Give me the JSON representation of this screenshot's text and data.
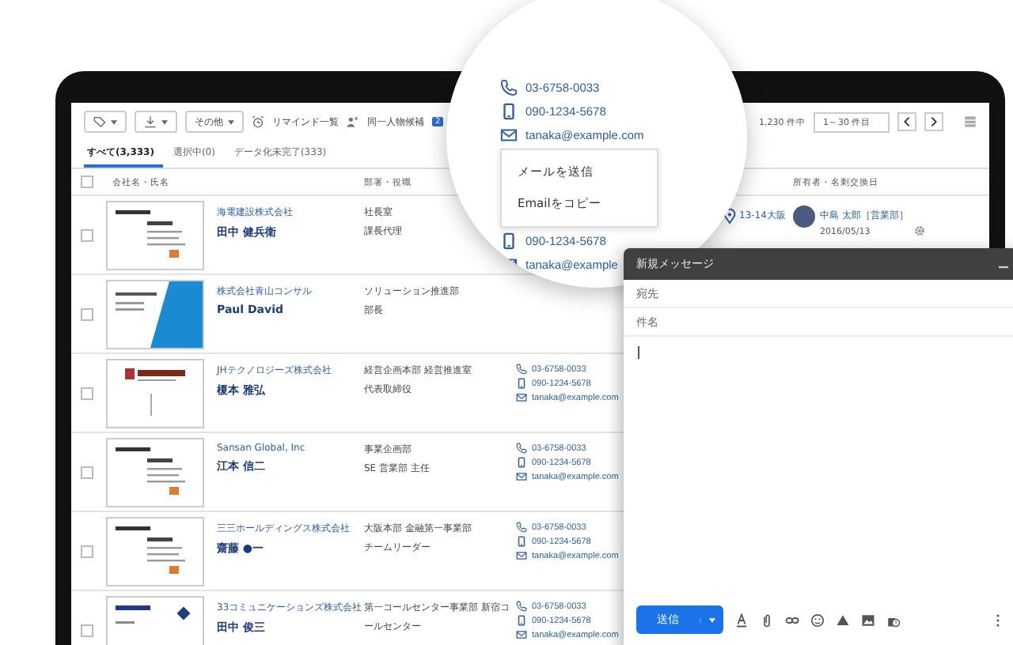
{
  "toolbar": {
    "more_menu": "その他",
    "reminder_link": "リマインド一覧",
    "duplicates_link": "同一人物候補",
    "duplicates_badge": "2"
  },
  "tabs": [
    {
      "label": "すべて(3,333)",
      "selected": true
    },
    {
      "label": "選択中(0)",
      "selected": false
    },
    {
      "label": "データ化未完了(333)",
      "selected": false
    }
  ],
  "pagination": {
    "total": "1,230 件中",
    "range": "1～30 件目"
  },
  "table": {
    "select_all_checked": false,
    "columns": [
      "会社名・氏名",
      "部署・役職",
      "所有者・名刺交換日"
    ],
    "rows": [
      {
        "checked": false,
        "kind": "plain",
        "company": "海電建設株式会社",
        "name": "田中 健兵衛",
        "department": "社長室",
        "title": "課長代理",
        "contacts": [],
        "address": "13-14大阪",
        "owner": "中島 太郎［営業部］",
        "date": "2016/05/13"
      },
      {
        "checked": false,
        "kind": "blue",
        "company": "株式会社青山コンサル",
        "name": "Paul David",
        "department": "ソリューション推進部",
        "title": "部長",
        "contacts": []
      },
      {
        "checked": false,
        "kind": "crest",
        "company": "JHテクノロジーズ株式会社",
        "name": "榎本 雅弘",
        "department": "経営企画本部 経営推進室",
        "title": "代表取締役",
        "contacts": [
          {
            "kind": "phone",
            "text": "03-6758-0033"
          },
          {
            "kind": "mobile",
            "text": "090-1234-5678"
          },
          {
            "kind": "email",
            "text": "tanaka@example.com"
          }
        ]
      },
      {
        "checked": false,
        "kind": "plain",
        "company": "Sansan Global, Inc",
        "name": "江本 信二",
        "department": "事業企画部",
        "title": "SE 営業部 主任",
        "contacts": [
          {
            "kind": "phone",
            "text": "03-6758-0033"
          },
          {
            "kind": "mobile",
            "text": "090-1234-5678"
          },
          {
            "kind": "email",
            "text": "tanaka@example.com"
          }
        ]
      },
      {
        "checked": false,
        "kind": "plain",
        "company": "三三ホールディングス株式会社",
        "name": "齋藤 ●一",
        "department": "大阪本部 金融第一事業部",
        "title": "チームリーダー",
        "contacts": [
          {
            "kind": "phone",
            "text": "03-6758-0033"
          },
          {
            "kind": "mobile",
            "text": "090-1234-5678"
          },
          {
            "kind": "email",
            "text": "tanaka@example.com"
          }
        ]
      },
      {
        "checked": false,
        "kind": "logo",
        "company": "33コミュニケーションズ株式会社",
        "name": "田中 俊三",
        "department": "第一コールセンター事業部 新宿コ",
        "title": "ールセンター",
        "contacts": [
          {
            "kind": "phone",
            "text": "03-6758-0033"
          },
          {
            "kind": "mobile",
            "text": "090-1234-5678"
          },
          {
            "kind": "email",
            "text": "tanaka@example.com"
          }
        ]
      }
    ]
  },
  "magnifier": {
    "contacts": [
      {
        "kind": "phone",
        "text": "03-6758-0033"
      },
      {
        "kind": "mobile",
        "text": "090-1234-5678"
      },
      {
        "kind": "email",
        "text": "tanaka@example.com"
      }
    ],
    "menu": [
      "メールを送信",
      "Emailをコピー"
    ],
    "contacts_below": [
      {
        "kind": "mobile",
        "text": "090-1234-5678"
      },
      {
        "kind": "email",
        "text": "tanaka@example"
      }
    ]
  },
  "compose": {
    "title": "新規メッセージ",
    "to_placeholder": "宛先",
    "subject_placeholder": "件名",
    "send": "送信"
  }
}
